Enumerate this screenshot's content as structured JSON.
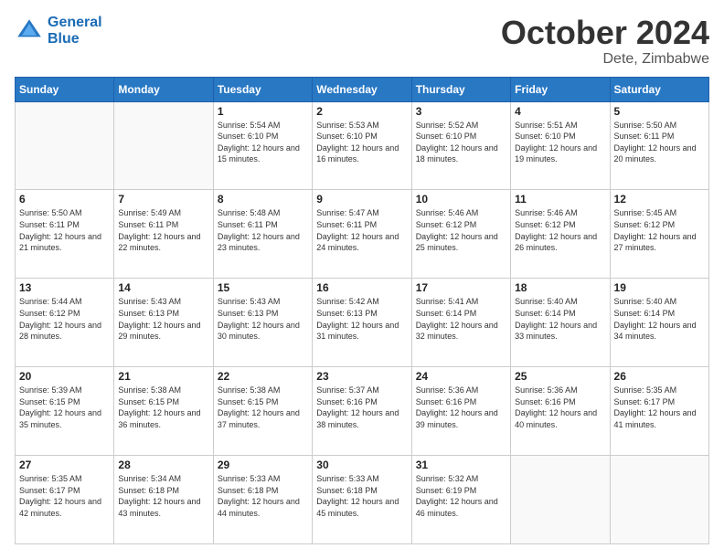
{
  "header": {
    "logo_line1": "General",
    "logo_line2": "Blue",
    "month": "October 2024",
    "location": "Dete, Zimbabwe"
  },
  "days_of_week": [
    "Sunday",
    "Monday",
    "Tuesday",
    "Wednesday",
    "Thursday",
    "Friday",
    "Saturday"
  ],
  "weeks": [
    [
      {
        "day": "",
        "info": ""
      },
      {
        "day": "",
        "info": ""
      },
      {
        "day": "1",
        "info": "Sunrise: 5:54 AM\nSunset: 6:10 PM\nDaylight: 12 hours and 15 minutes."
      },
      {
        "day": "2",
        "info": "Sunrise: 5:53 AM\nSunset: 6:10 PM\nDaylight: 12 hours and 16 minutes."
      },
      {
        "day": "3",
        "info": "Sunrise: 5:52 AM\nSunset: 6:10 PM\nDaylight: 12 hours and 18 minutes."
      },
      {
        "day": "4",
        "info": "Sunrise: 5:51 AM\nSunset: 6:10 PM\nDaylight: 12 hours and 19 minutes."
      },
      {
        "day": "5",
        "info": "Sunrise: 5:50 AM\nSunset: 6:11 PM\nDaylight: 12 hours and 20 minutes."
      }
    ],
    [
      {
        "day": "6",
        "info": "Sunrise: 5:50 AM\nSunset: 6:11 PM\nDaylight: 12 hours and 21 minutes."
      },
      {
        "day": "7",
        "info": "Sunrise: 5:49 AM\nSunset: 6:11 PM\nDaylight: 12 hours and 22 minutes."
      },
      {
        "day": "8",
        "info": "Sunrise: 5:48 AM\nSunset: 6:11 PM\nDaylight: 12 hours and 23 minutes."
      },
      {
        "day": "9",
        "info": "Sunrise: 5:47 AM\nSunset: 6:11 PM\nDaylight: 12 hours and 24 minutes."
      },
      {
        "day": "10",
        "info": "Sunrise: 5:46 AM\nSunset: 6:12 PM\nDaylight: 12 hours and 25 minutes."
      },
      {
        "day": "11",
        "info": "Sunrise: 5:46 AM\nSunset: 6:12 PM\nDaylight: 12 hours and 26 minutes."
      },
      {
        "day": "12",
        "info": "Sunrise: 5:45 AM\nSunset: 6:12 PM\nDaylight: 12 hours and 27 minutes."
      }
    ],
    [
      {
        "day": "13",
        "info": "Sunrise: 5:44 AM\nSunset: 6:12 PM\nDaylight: 12 hours and 28 minutes."
      },
      {
        "day": "14",
        "info": "Sunrise: 5:43 AM\nSunset: 6:13 PM\nDaylight: 12 hours and 29 minutes."
      },
      {
        "day": "15",
        "info": "Sunrise: 5:43 AM\nSunset: 6:13 PM\nDaylight: 12 hours and 30 minutes."
      },
      {
        "day": "16",
        "info": "Sunrise: 5:42 AM\nSunset: 6:13 PM\nDaylight: 12 hours and 31 minutes."
      },
      {
        "day": "17",
        "info": "Sunrise: 5:41 AM\nSunset: 6:14 PM\nDaylight: 12 hours and 32 minutes."
      },
      {
        "day": "18",
        "info": "Sunrise: 5:40 AM\nSunset: 6:14 PM\nDaylight: 12 hours and 33 minutes."
      },
      {
        "day": "19",
        "info": "Sunrise: 5:40 AM\nSunset: 6:14 PM\nDaylight: 12 hours and 34 minutes."
      }
    ],
    [
      {
        "day": "20",
        "info": "Sunrise: 5:39 AM\nSunset: 6:15 PM\nDaylight: 12 hours and 35 minutes."
      },
      {
        "day": "21",
        "info": "Sunrise: 5:38 AM\nSunset: 6:15 PM\nDaylight: 12 hours and 36 minutes."
      },
      {
        "day": "22",
        "info": "Sunrise: 5:38 AM\nSunset: 6:15 PM\nDaylight: 12 hours and 37 minutes."
      },
      {
        "day": "23",
        "info": "Sunrise: 5:37 AM\nSunset: 6:16 PM\nDaylight: 12 hours and 38 minutes."
      },
      {
        "day": "24",
        "info": "Sunrise: 5:36 AM\nSunset: 6:16 PM\nDaylight: 12 hours and 39 minutes."
      },
      {
        "day": "25",
        "info": "Sunrise: 5:36 AM\nSunset: 6:16 PM\nDaylight: 12 hours and 40 minutes."
      },
      {
        "day": "26",
        "info": "Sunrise: 5:35 AM\nSunset: 6:17 PM\nDaylight: 12 hours and 41 minutes."
      }
    ],
    [
      {
        "day": "27",
        "info": "Sunrise: 5:35 AM\nSunset: 6:17 PM\nDaylight: 12 hours and 42 minutes."
      },
      {
        "day": "28",
        "info": "Sunrise: 5:34 AM\nSunset: 6:18 PM\nDaylight: 12 hours and 43 minutes."
      },
      {
        "day": "29",
        "info": "Sunrise: 5:33 AM\nSunset: 6:18 PM\nDaylight: 12 hours and 44 minutes."
      },
      {
        "day": "30",
        "info": "Sunrise: 5:33 AM\nSunset: 6:18 PM\nDaylight: 12 hours and 45 minutes."
      },
      {
        "day": "31",
        "info": "Sunrise: 5:32 AM\nSunset: 6:19 PM\nDaylight: 12 hours and 46 minutes."
      },
      {
        "day": "",
        "info": ""
      },
      {
        "day": "",
        "info": ""
      }
    ]
  ]
}
